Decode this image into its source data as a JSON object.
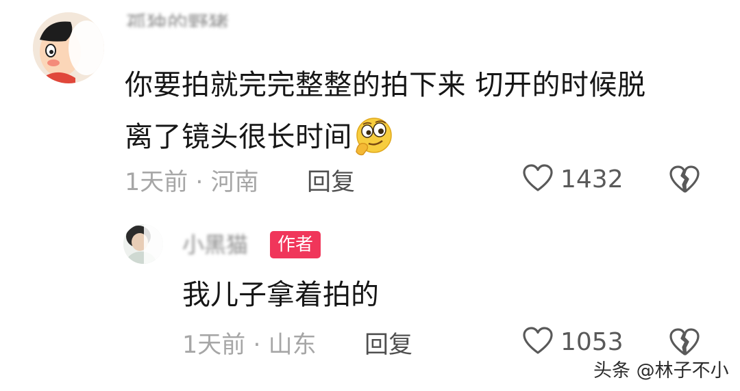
{
  "comment": {
    "avatar_icon": "cartoon-avatar-icon",
    "username": "孤独的野猪",
    "text_line1": "你要拍就完完整整的拍下来  切开的时候脱",
    "text_line2": "离了镜头很长时间",
    "emoji_icon": "thinking-smirk-emoji-icon",
    "meta": "1天前 · 河南",
    "reply_label": "回复",
    "like_icon": "heart-icon",
    "like_count": "1432",
    "dislike_icon": "broken-heart-icon"
  },
  "reply": {
    "avatar_icon": "user-avatar-icon",
    "username": "小黑猫",
    "badge": "作者",
    "text": "我儿子拿着拍的",
    "meta": "1天前 · 山东",
    "reply_label": "回复",
    "like_icon": "heart-icon",
    "like_count": "1053",
    "dislike_icon": "broken-heart-icon"
  },
  "watermark": "头条 @林子不小",
  "colors": {
    "badge": "#f0365a",
    "text": "#161616",
    "meta": "#a6a6a6",
    "icon": "#595959"
  }
}
